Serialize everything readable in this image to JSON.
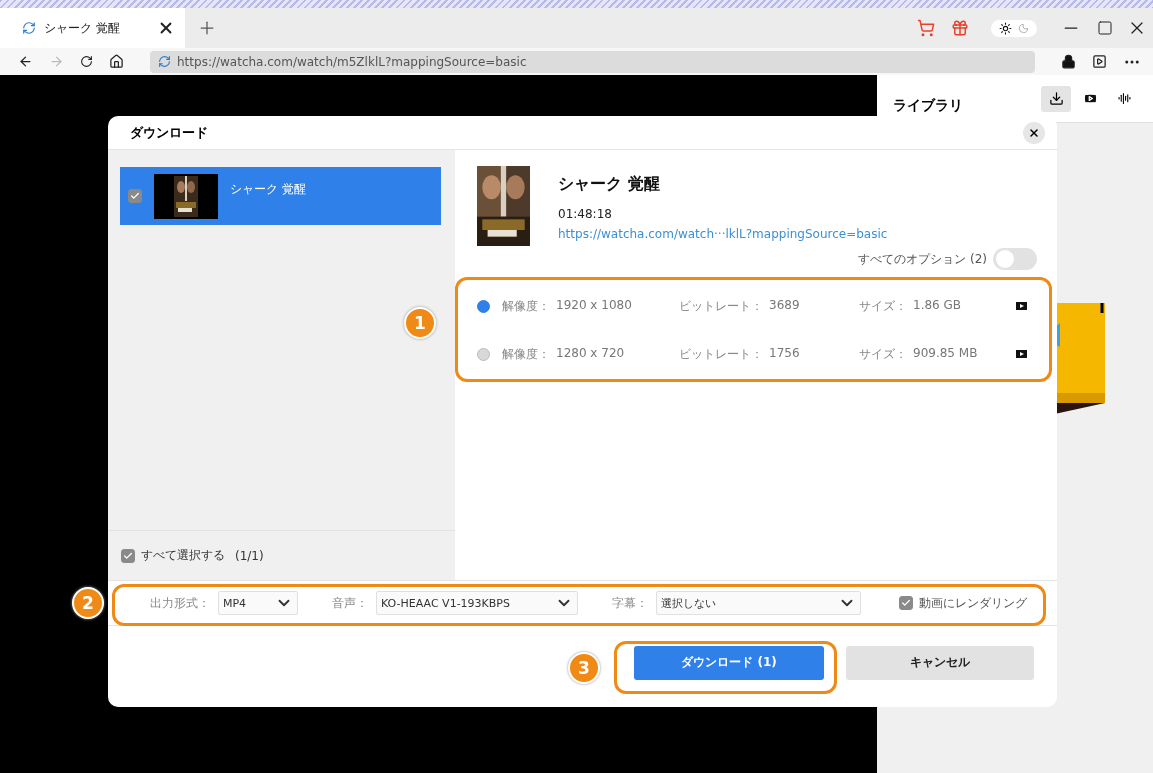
{
  "browser": {
    "tab": {
      "title": "シャーク 覚醒"
    },
    "address": "https://watcha.com/watch/m5ZlklL?mappingSource=basic",
    "theme": {
      "dark": false
    }
  },
  "library": {
    "title": "ライブラリ",
    "tabs": [
      {
        "kind": "download",
        "selected": true
      },
      {
        "kind": "video",
        "selected": false
      },
      {
        "kind": "audio",
        "selected": false
      }
    ]
  },
  "dialog": {
    "title": "ダウンロード",
    "items": [
      {
        "title": "シャーク 覚醒",
        "checked": true,
        "selected": true
      }
    ],
    "select_all": {
      "label": "すべて選択する",
      "count": "(1/1)",
      "checked": true
    },
    "detail": {
      "title": "シャーク 覚醒",
      "duration": "01:48:18",
      "url": "https://watcha.com/watch···lklL?mappingSource=basic",
      "all_options": {
        "label": "すべてのオプション (2)",
        "on": false
      }
    },
    "options": [
      {
        "resolution_label": "解像度：",
        "resolution": "1920 x 1080",
        "bitrate_label": "ビットレート：",
        "bitrate": "3689",
        "size_label": "サイズ：",
        "size": "1.86 GB",
        "selected": true
      },
      {
        "resolution_label": "解像度：",
        "resolution": "1280 x 720",
        "bitrate_label": "ビットレート：",
        "bitrate": "1756",
        "size_label": "サイズ：",
        "size": "909.85 MB",
        "selected": false
      }
    ],
    "settings": [
      {
        "label": "出力形式：",
        "value": "MP4"
      },
      {
        "label": "音声：",
        "value": "KO-HEAAC V1-193KBPS"
      },
      {
        "label": "字幕：",
        "value": "選択しない"
      }
    ],
    "render": {
      "label": "動画にレンダリング",
      "checked": true
    },
    "buttons": [
      {
        "kind": "primary",
        "label": "ダウンロード (1)"
      },
      {
        "kind": "secondary",
        "label": "キャンセル"
      }
    ]
  },
  "annotations": [
    {
      "label": "1"
    },
    {
      "label": "2"
    },
    {
      "label": "3"
    }
  ]
}
